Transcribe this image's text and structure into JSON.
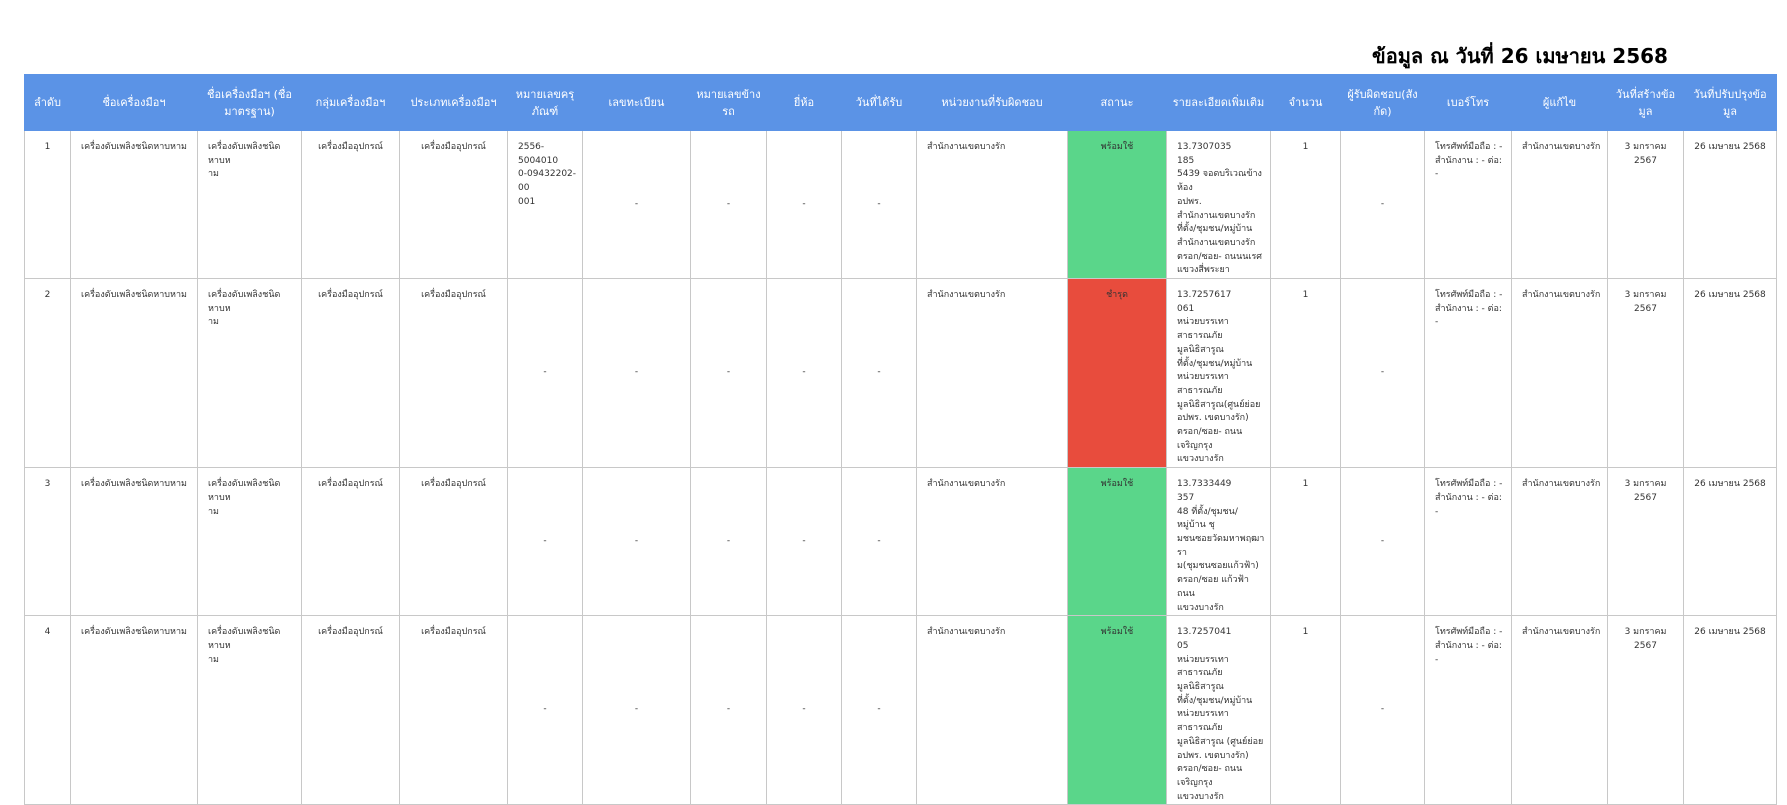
{
  "header": {
    "date_title": "ข้อมูล ณ วันที่ 26 เมษายน 2568"
  },
  "columns": [
    "ลำดับ",
    "ชื่อเครื่องมือฯ",
    "ชื่อเครื่องมือฯ\n(ชื่อมาตรฐาน)",
    "กลุ่มเครื่องมือฯ",
    "ประเภทเครื่องมือฯ",
    "หมายเลขครุ\nภัณฑ์",
    "เลขทะเบียน",
    "หมายเลขข้าง\nรถ",
    "ยี่ห้อ",
    "วันที่ได้รับ",
    "หน่วยงานที่รับผิดชอบ",
    "สถานะ",
    "รายละเอียดเพิ่มเติม",
    "จำนวน",
    "ผู้รับผิดชอบ(สัง\nกัด)",
    "เบอร์โทร",
    "ผู้แก้ไข",
    "วันที่สร้างข้อ\nมูล",
    "วันที่ปรับปรุงข้อ\nมูล"
  ],
  "status_colors": {
    "ready": "#5ad68a",
    "broken": "#e84c3d"
  },
  "rows": [
    {
      "no": "1",
      "name": "เครื่องดับเพลิงชนิดหาบหาม",
      "std_name": "เครื่องดับเพลิงชนิดหาบห\nาม",
      "group": "เครื่องมืออุปกรณ์",
      "type": "เครื่องมืออุปกรณ์",
      "asset_no": "2556-5004010\n0-09432202-00\n001",
      "reg_no": "-",
      "vehicle_no": "-",
      "brand": "-",
      "received": "-",
      "dept": "สำนักงานเขตบางรัก",
      "status": "พร้อมใช้",
      "status_key": "ready",
      "detail": "13.7307035\n185\n5439 จอดบริเวณข้างห้อง\nอปพร.\nสำนักงานเขตบางรัก\nที่ตั้ง/ชุมชน/หมู่บ้าน\nสำนักงานเขตบางรัก\nตรอก/ซอย- ถนนนเรศ\nแขวงสี่พระยา",
      "qty": "1",
      "owner": "-",
      "phone": "โทรศัพท์มือถือ : -\nสำนักงาน : -  ต่อ: -",
      "editor": "สำนักงานเขตบางรัก",
      "created": "3 มกราคม 2567",
      "updated": "26 เมษายน 2568"
    },
    {
      "no": "2",
      "name": "เครื่องดับเพลิงชนิดหาบหาม",
      "std_name": "เครื่องดับเพลิงชนิดหาบห\nาม",
      "group": "เครื่องมืออุปกรณ์",
      "type": "เครื่องมืออุปกรณ์",
      "asset_no": "-",
      "reg_no": "-",
      "vehicle_no": "-",
      "brand": "-",
      "received": "-",
      "dept": "สำนักงานเขตบางรัก",
      "status": "ชำรุด",
      "status_key": "broken",
      "detail": "13.7257617\n061\nหน่วยบรรเทาสาธารณภัย\nมูลนิธิสารูณ\nที่ตั้ง/ชุมชน/หมู่บ้าน\nหน่วยบรรเทาสาธารณภัย\nมูลนิธิสารูณ(ศูนย์ย่อย\nอปพร. เขตบางรัก)\nตรอก/ซอย- ถนนเจริญกรุง\nแขวงบางรัก",
      "qty": "1",
      "owner": "-",
      "phone": "โทรศัพท์มือถือ : -\nสำนักงาน : -  ต่อ: -",
      "editor": "สำนักงานเขตบางรัก",
      "created": "3 มกราคม 2567",
      "updated": "26 เมษายน 2568"
    },
    {
      "no": "3",
      "name": "เครื่องดับเพลิงชนิดหาบหาม",
      "std_name": "เครื่องดับเพลิงชนิดหาบห\nาม",
      "group": "เครื่องมืออุปกรณ์",
      "type": "เครื่องมืออุปกรณ์",
      "asset_no": "-",
      "reg_no": "-",
      "vehicle_no": "-",
      "brand": "-",
      "received": "-",
      "dept": "สำนักงานเขตบางรัก",
      "status": "พร้อมใช้",
      "status_key": "ready",
      "detail": "13.7333449\n357\n48 ที่ตั้ง/ชุมชน/หมู่บ้าน ชุ\nมชนซอยวัดมหาพฤฒารา\nม(ชุมชนซอยแก้วฟ้า)\nตรอก/ซอย แก้วฟ้า ถนน\nแขวงบางรัก",
      "qty": "1",
      "owner": "-",
      "phone": "โทรศัพท์มือถือ : -\nสำนักงาน : -  ต่อ: -",
      "editor": "สำนักงานเขตบางรัก",
      "created": "3 มกราคม 2567",
      "updated": "26 เมษายน 2568"
    },
    {
      "no": "4",
      "name": "เครื่องดับเพลิงชนิดหาบหาม",
      "std_name": "เครื่องดับเพลิงชนิดหาบห\nาม",
      "group": "เครื่องมืออุปกรณ์",
      "type": "เครื่องมืออุปกรณ์",
      "asset_no": "-",
      "reg_no": "-",
      "vehicle_no": "-",
      "brand": "-",
      "received": "-",
      "dept": "สำนักงานเขตบางรัก",
      "status": "พร้อมใช้",
      "status_key": "ready",
      "detail": "13.7257041\n05\nหน่วยบรรเทาสาธารณภัย\nมูลนิธิสารูณ\nที่ตั้ง/ชุมชน/หมู่บ้าน\nหน่วยบรรเทาสาธารณภัย\nมูลนิธิสารูณ (ศูนย์ย่อย\nอปพร. เขตบางรัก)\nตรอก/ซอย- ถนนเจริญกรุง\nแขวงบางรัก",
      "qty": "1",
      "owner": "-",
      "phone": "โทรศัพท์มือถือ : -\nสำนักงาน : -  ต่อ: -",
      "editor": "สำนักงานเขตบางรัก",
      "created": "3 มกราคม 2567",
      "updated": "26 เมษายน 2568"
    }
  ]
}
